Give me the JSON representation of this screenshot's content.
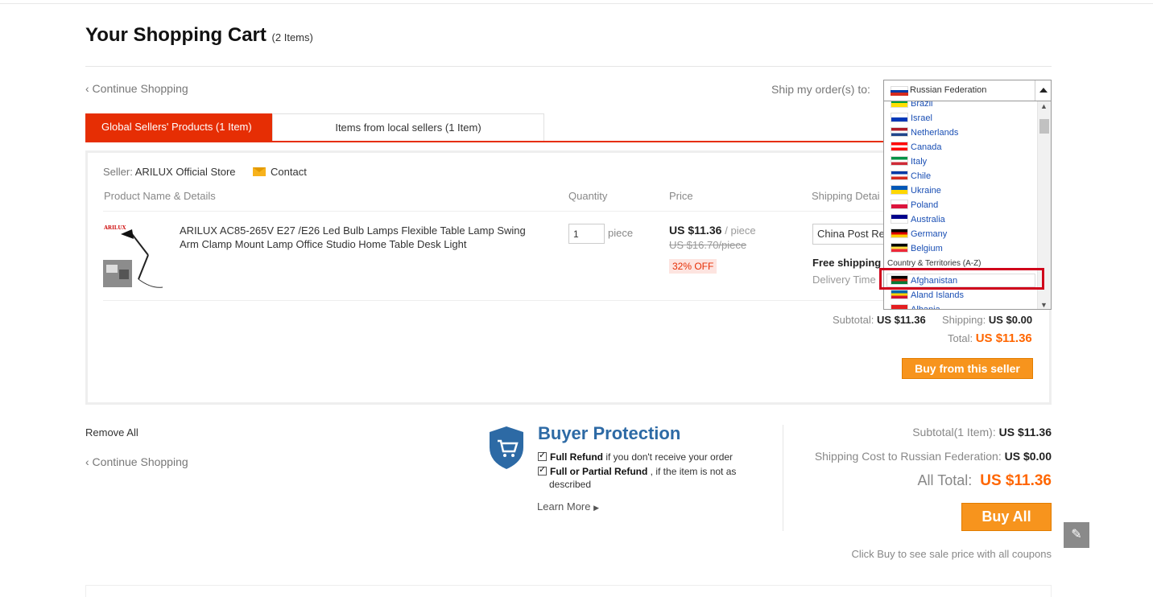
{
  "header": {
    "title": "Your Shopping Cart",
    "item_count": "(2 Items)",
    "continue_shopping": "‹ Continue Shopping",
    "ship_to_label": "Ship my order(s) to:"
  },
  "tabs": [
    {
      "label": "Global Sellers' Products (1 Item)"
    },
    {
      "label": "Items from local sellers (1 Item)"
    }
  ],
  "seller": {
    "label": "Seller:",
    "name": "ARILUX Official Store",
    "contact": "Contact"
  },
  "columns": {
    "product": "Product Name & Details",
    "quantity": "Quantity",
    "price": "Price",
    "shipping": "Shipping Detai"
  },
  "item": {
    "name": "ARILUX AC85-265V E27 /E26 Led Bulb Lamps Flexible Table Lamp Swing Arm Clamp Mount Lamp Office Studio Home Table Desk Light",
    "brand_mark": "ARILUX",
    "quantity": "1",
    "unit": "piece",
    "price": "US $11.36",
    "per_piece": "/ piece",
    "old_price": "US $16.70/piece",
    "discount": "32% OFF",
    "shipping_method": "China Post Reg",
    "free_shipping": "Free shipping",
    "delivery_time": "Delivery Time"
  },
  "seller_totals": {
    "subtotal_label": "Subtotal:",
    "subtotal": "US $11.36",
    "shipping_label": "Shipping:",
    "shipping": "US $0.00",
    "total_label": "Total:",
    "total": "US $11.36",
    "buy_button": "Buy from this seller"
  },
  "footer": {
    "remove_all": "Remove All",
    "continue_shopping": "‹ Continue Shopping"
  },
  "protection": {
    "title": "Buyer Protection",
    "line1_bold": "Full Refund",
    "line1_rest": " if you don't receive your order",
    "line2_bold": "Full or Partial Refund",
    "line2_rest": " , if the item is not as",
    "line2_cont": "described",
    "learn_more": "Learn More"
  },
  "summary": {
    "subtotal_label": "Subtotal(1 Item):",
    "subtotal": "US $11.36",
    "shipping_label": "Shipping Cost to Russian Federation:",
    "shipping": "US $0.00",
    "all_total_label": "All Total:",
    "all_total": "US $11.36",
    "buy_all": "Buy All",
    "coupon_note": "Click Buy to see sale price with all coupons"
  },
  "country_dropdown": {
    "selected": "Russian Federation",
    "section_heading": "Country & Territories (A-Z)",
    "options": [
      {
        "name": "Brazil",
        "colors": [
          "#009c3b",
          "#ffdf00"
        ]
      },
      {
        "name": "Israel",
        "colors": [
          "#ffffff",
          "#0038b8"
        ]
      },
      {
        "name": "Netherlands",
        "colors": [
          "#ae1c28",
          "#ffffff",
          "#21468b"
        ]
      },
      {
        "name": "Canada",
        "colors": [
          "#ff0000",
          "#ffffff",
          "#ff0000"
        ]
      },
      {
        "name": "Italy",
        "colors": [
          "#009246",
          "#ffffff",
          "#ce2b37"
        ]
      },
      {
        "name": "Chile",
        "colors": [
          "#0039a6",
          "#ffffff",
          "#d52b1e"
        ]
      },
      {
        "name": "Ukraine",
        "colors": [
          "#0057b7",
          "#ffd700"
        ]
      },
      {
        "name": "Poland",
        "colors": [
          "#ffffff",
          "#dc143c"
        ]
      },
      {
        "name": "Australia",
        "colors": [
          "#00008b",
          "#ffffff"
        ]
      },
      {
        "name": "Germany",
        "colors": [
          "#000000",
          "#dd0000",
          "#ffce00"
        ]
      },
      {
        "name": "Belgium",
        "colors": [
          "#000000",
          "#fae042",
          "#ed2939"
        ]
      }
    ],
    "az_options": [
      {
        "name": "Afghanistan",
        "colors": [
          "#000000",
          "#d32011",
          "#007a36"
        ]
      },
      {
        "name": "Aland Islands",
        "colors": [
          "#0064ad",
          "#ffd300",
          "#d21034"
        ]
      },
      {
        "name": "Albania",
        "colors": [
          "#e41e20",
          "#000000"
        ]
      }
    ]
  }
}
